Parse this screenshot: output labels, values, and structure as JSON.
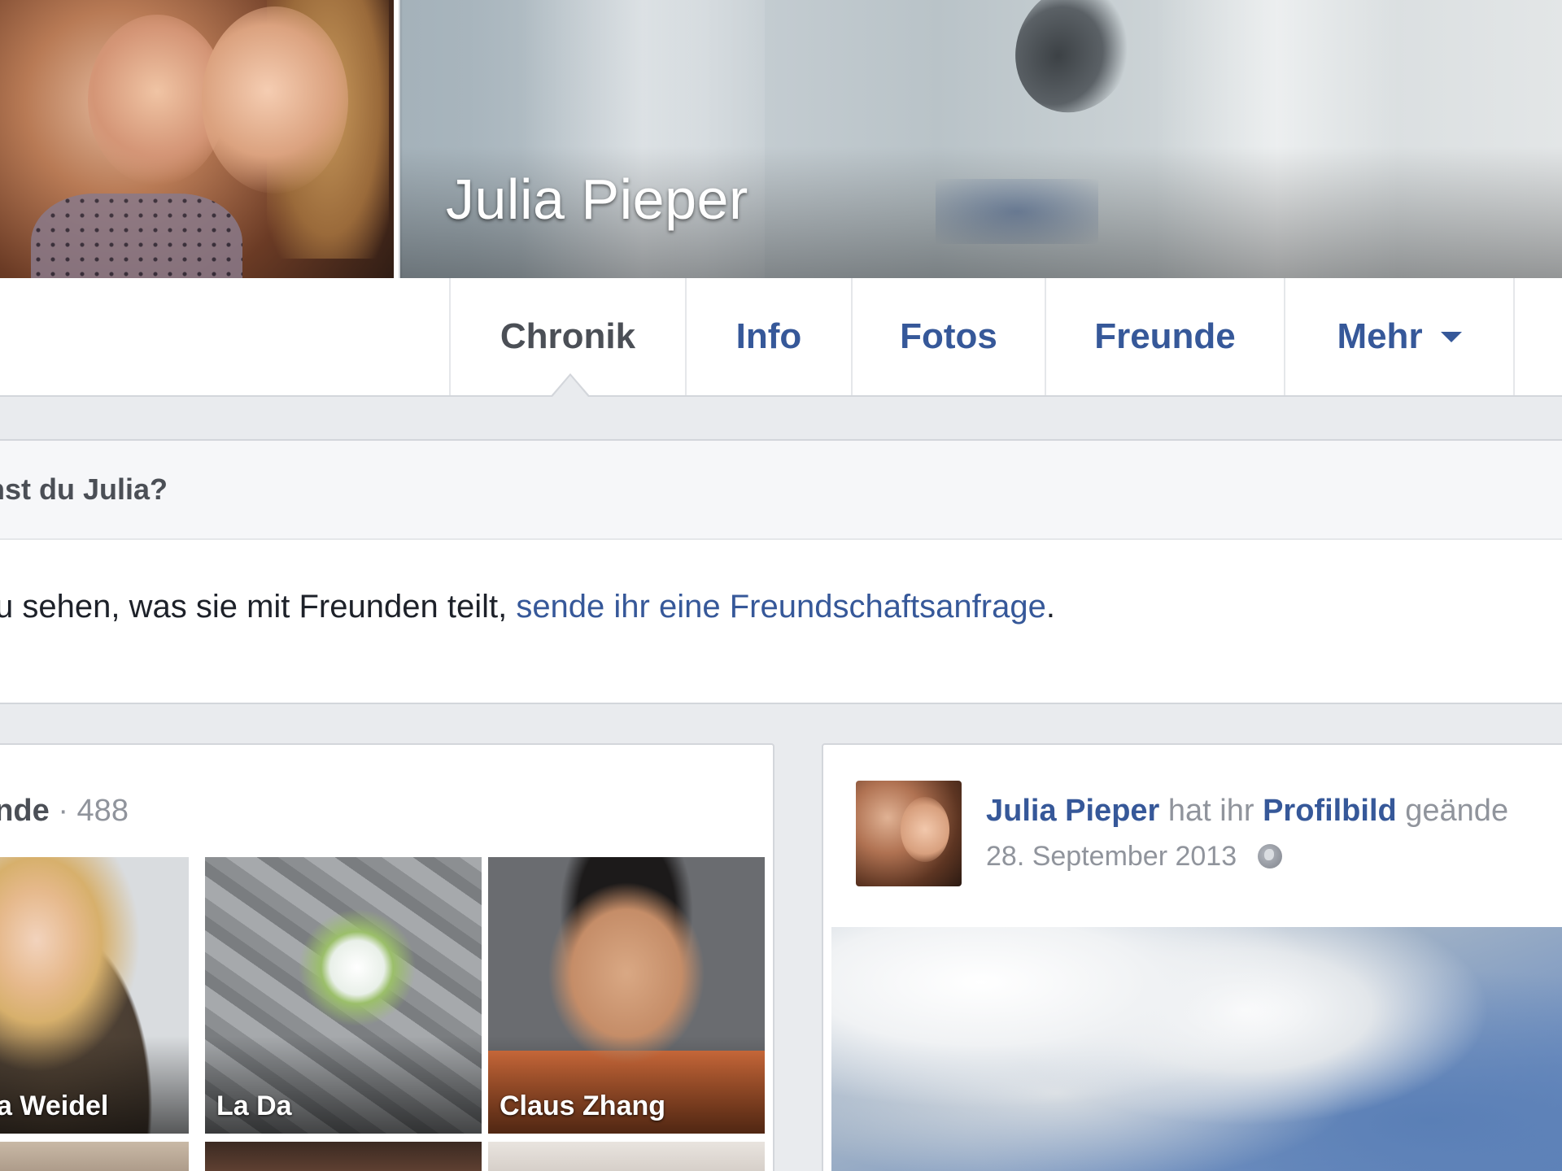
{
  "profile": {
    "name": "Julia Pieper"
  },
  "tabs": [
    {
      "label": "Chronik",
      "active": true
    },
    {
      "label": "Info",
      "active": false
    },
    {
      "label": "Fotos",
      "active": false
    },
    {
      "label": "Freunde",
      "active": false
    },
    {
      "label": "Mehr",
      "active": false
    }
  ],
  "know_box": {
    "heading": "nnst du Julia?",
    "text_before": "zu sehen, was sie mit Freunden teilt, ",
    "link": "sende ihr eine Freundschaftsanfrage",
    "text_after": "."
  },
  "friends": {
    "title": "unde",
    "count": " · 488",
    "tiles": [
      {
        "name": "a Weidel"
      },
      {
        "name": "La Da"
      },
      {
        "name": "Claus Zhang"
      }
    ]
  },
  "post": {
    "author": "Julia Pieper",
    "middle": " hat ihr ",
    "link": "Profilbild",
    "end": " geände",
    "date": "28. September 2013",
    "privacy_icon": "globe-icon"
  },
  "colors": {
    "link": "#365899",
    "background": "#e9ebee",
    "border": "#d3d6db"
  }
}
